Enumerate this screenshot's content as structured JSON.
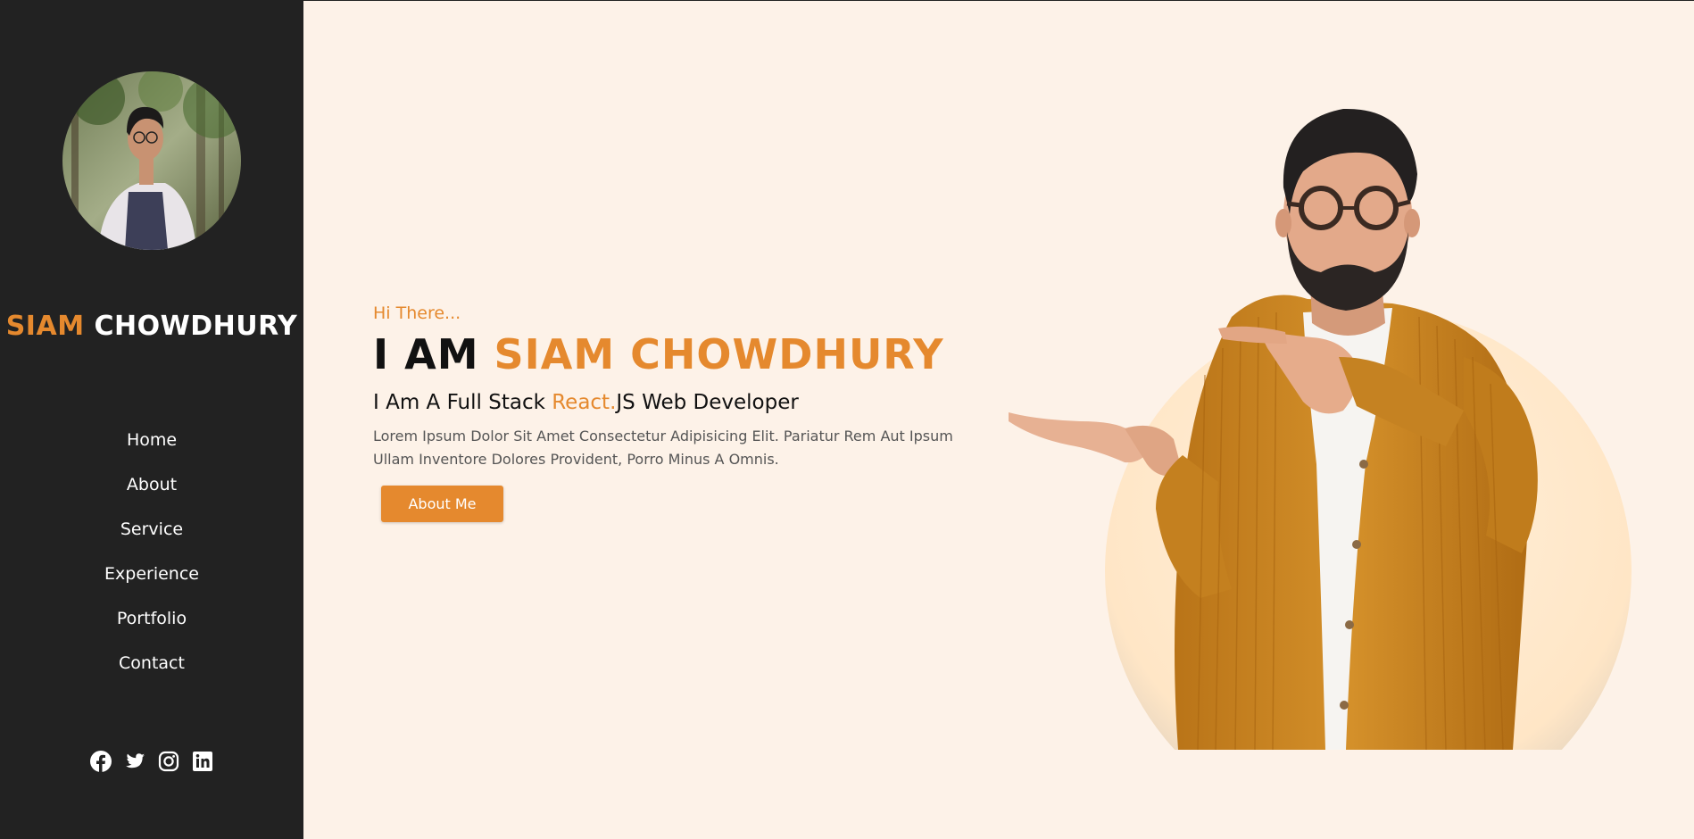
{
  "sidebar": {
    "brand_first": "SIAM",
    "brand_last": "CHOWDHURY",
    "nav": [
      "Home",
      "About",
      "Service",
      "Experience",
      "Portfolio",
      "Contact"
    ],
    "social_icons": [
      "facebook-icon",
      "twitter-icon",
      "instagram-icon",
      "linkedin-icon"
    ]
  },
  "hero": {
    "greeting": "Hi There...",
    "headline_prefix": "I AM",
    "headline_name": "SIAM CHOWDHURY",
    "subtitle_pre": "I Am A Full Stack",
    "subtitle_accent": "React.",
    "subtitle_post": "JS Web Developer",
    "description": "Lorem Ipsum Dolor Sit Amet Consectetur Adipisicing Elit. Pariatur Rem Aut Ipsum Ullam Inventore Dolores Provident, Porro Minus A Omnis.",
    "button_label": "About Me"
  },
  "colors": {
    "accent": "#e5892e",
    "sidebar_bg": "#222222",
    "page_bg": "#fdf2e8"
  }
}
